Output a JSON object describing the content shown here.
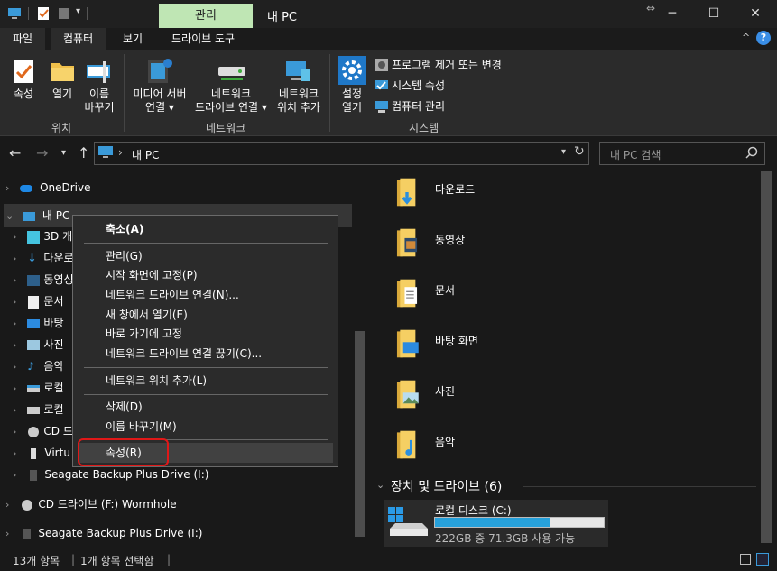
{
  "window": {
    "context_tab": "관리",
    "title": "내 PC",
    "minimize": "─",
    "maximize": "☐",
    "close": "✕",
    "restore_hint": "⇔"
  },
  "ribbon_tabs": [
    "파일",
    "컴퓨터",
    "보기",
    "드라이브 도구"
  ],
  "ribbon": {
    "location": {
      "label": "위치",
      "buttons": [
        {
          "label": "속성",
          "icon": "properties-icon"
        },
        {
          "label": "열기",
          "icon": "open-folder-icon"
        },
        {
          "label": "이름\n바꾸기",
          "icon": "rename-icon"
        }
      ]
    },
    "network": {
      "label": "네트워크",
      "buttons": [
        {
          "label": "미디어 서버\n연결 ▾",
          "icon": "media-server-icon"
        },
        {
          "label": "네트워크\n드라이브 연결 ▾",
          "icon": "network-drive-icon"
        },
        {
          "label": "네트워크\n위치 추가",
          "icon": "network-location-icon"
        }
      ]
    },
    "system": {
      "label": "시스템",
      "open_settings": "설정\n열기",
      "items": [
        "프로그램 제거 또는 변경",
        "시스템 속성",
        "컴퓨터 관리"
      ]
    }
  },
  "address": {
    "path": "내 PC",
    "search_placeholder": "내 PC 검색"
  },
  "nav_tree": [
    {
      "label": "OneDrive",
      "icon": "onedrive-icon",
      "level": 0
    },
    {
      "label": "내 PC",
      "icon": "this-pc-icon",
      "level": 0,
      "expanded": true
    },
    {
      "label": "3D 개",
      "icon": "3d-objects-icon",
      "level": 1
    },
    {
      "label": "다운로",
      "icon": "download-icon",
      "level": 1
    },
    {
      "label": "동영싱",
      "icon": "video-icon",
      "level": 1
    },
    {
      "label": "문서",
      "icon": "document-icon",
      "level": 1
    },
    {
      "label": "바탕",
      "icon": "desktop-icon",
      "level": 1
    },
    {
      "label": "사진",
      "icon": "picture-icon",
      "level": 1
    },
    {
      "label": "음악",
      "icon": "music-icon",
      "level": 1
    },
    {
      "label": "로컬",
      "icon": "local-disk-icon",
      "level": 1
    },
    {
      "label": "로컬",
      "icon": "drive-icon",
      "level": 1
    },
    {
      "label": "CD 드",
      "icon": "cd-drive-icon",
      "level": 1
    },
    {
      "label": "Virtu",
      "icon": "usb-icon",
      "level": 1
    },
    {
      "label": "Seagate Backup Plus Drive (I:)",
      "icon": "external-drive-icon",
      "level": 1
    },
    {
      "label": "CD 드라이브 (F:) Wormhole",
      "icon": "cd-drive-icon",
      "level": 0
    },
    {
      "label": "Seagate Backup Plus Drive (I:)",
      "icon": "external-drive-icon",
      "level": 0
    }
  ],
  "context_menu": {
    "items": [
      {
        "label": "축소(A)",
        "bold": true
      },
      {
        "label": "관리(G)"
      },
      {
        "label": "시작 화면에 고정(P)"
      },
      {
        "label": "네트워크 드라이브 연결(N)..."
      },
      {
        "label": "새 창에서 열기(E)"
      },
      {
        "label": "바로 가기에 고정"
      },
      {
        "label": "네트워크 드라이브 연결 끊기(C)..."
      },
      {
        "label": "네트워크 위치 추가(L)"
      },
      {
        "label": "삭제(D)"
      },
      {
        "label": "이름 바꾸기(M)"
      },
      {
        "label": "속성(R)",
        "highlighted": true
      }
    ]
  },
  "folders": [
    {
      "label": "다운로드",
      "icon": "download-folder-icon"
    },
    {
      "label": "동영상",
      "icon": "video-folder-icon"
    },
    {
      "label": "문서",
      "icon": "document-folder-icon"
    },
    {
      "label": "바탕 화면",
      "icon": "desktop-folder-icon"
    },
    {
      "label": "사진",
      "icon": "picture-folder-icon"
    },
    {
      "label": "음악",
      "icon": "music-folder-icon"
    }
  ],
  "devices": {
    "header": "장치 및 드라이브 (6)",
    "drive": {
      "name": "로컬 디스크 (C:)",
      "space": "222GB 중 71.3GB 사용 가능",
      "used_fraction": 0.68
    }
  },
  "status": {
    "count": "13개 항목",
    "selected": "1개 항목 선택함"
  },
  "colors": {
    "accent": "#26a0da",
    "context_tab_bg": "#bfe6b4",
    "highlight_border": "#e01818"
  }
}
